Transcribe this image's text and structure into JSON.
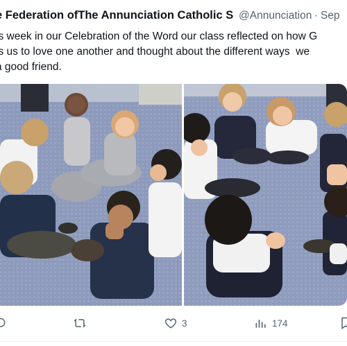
{
  "tweet": {
    "author_name": "e Federation ofThe Annunciation Catholic S",
    "handle_time": "@Annunciation · Sep",
    "text_lines": [
      "is week in our Celebration of the Word our class reflected on how G",
      "ls us to love one another and thought about the different ways  we",
      "a good friend."
    ]
  },
  "actions": {
    "retweet_count": "",
    "like_count": "3",
    "views_count": "174"
  },
  "colors": {
    "text_primary": "#0f1419",
    "text_secondary": "#536471",
    "carpet": "#8a97b8"
  },
  "icons": [
    "reply-icon",
    "retweet-icon",
    "like-icon",
    "views-icon",
    "bookmark-icon"
  ]
}
